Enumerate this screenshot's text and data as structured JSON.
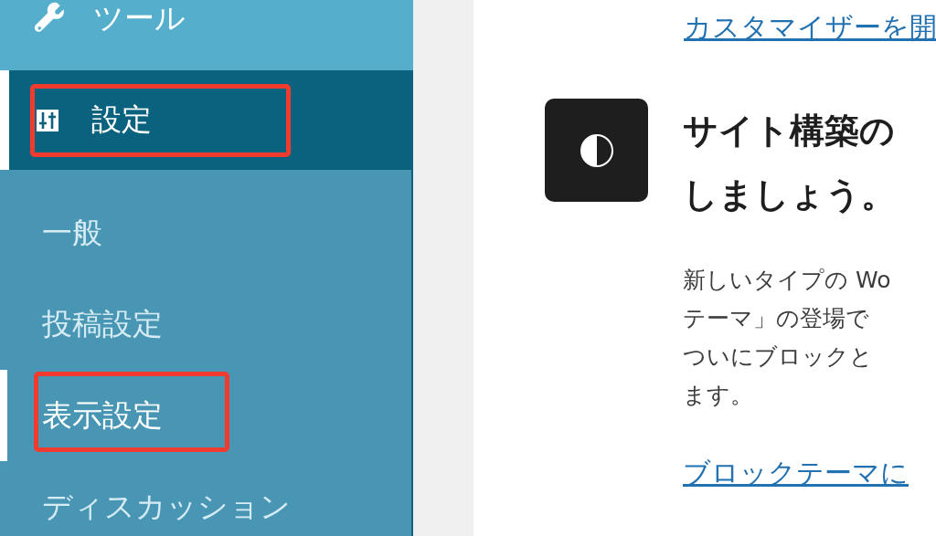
{
  "menu": [
    {
      "kind": "menu",
      "label": "ツール",
      "selected": false,
      "highlighted": false
    },
    {
      "kind": "menu",
      "label": "設定",
      "selected": true,
      "highlighted": true,
      "children": [
        {
          "label": "一般",
          "selected": false,
          "highlighted": false
        },
        {
          "label": "投稿設定",
          "selected": false,
          "highlighted": false
        },
        {
          "label": "表示設定",
          "selected": true,
          "highlighted": true
        },
        {
          "label": "ディスカッション",
          "selected": false,
          "highlighted": false
        }
      ]
    }
  ],
  "content": {
    "top_link": "カスタマイザーを開",
    "card": {
      "heading_lines": [
        "サイト構築の",
        "しましょう。"
      ],
      "paragraph_lines": [
        "新しいタイプの Wo",
        "テーマ」の登場で",
        "ついにブロックと",
        "ます。"
      ],
      "link": "ブロックテーマに"
    }
  }
}
